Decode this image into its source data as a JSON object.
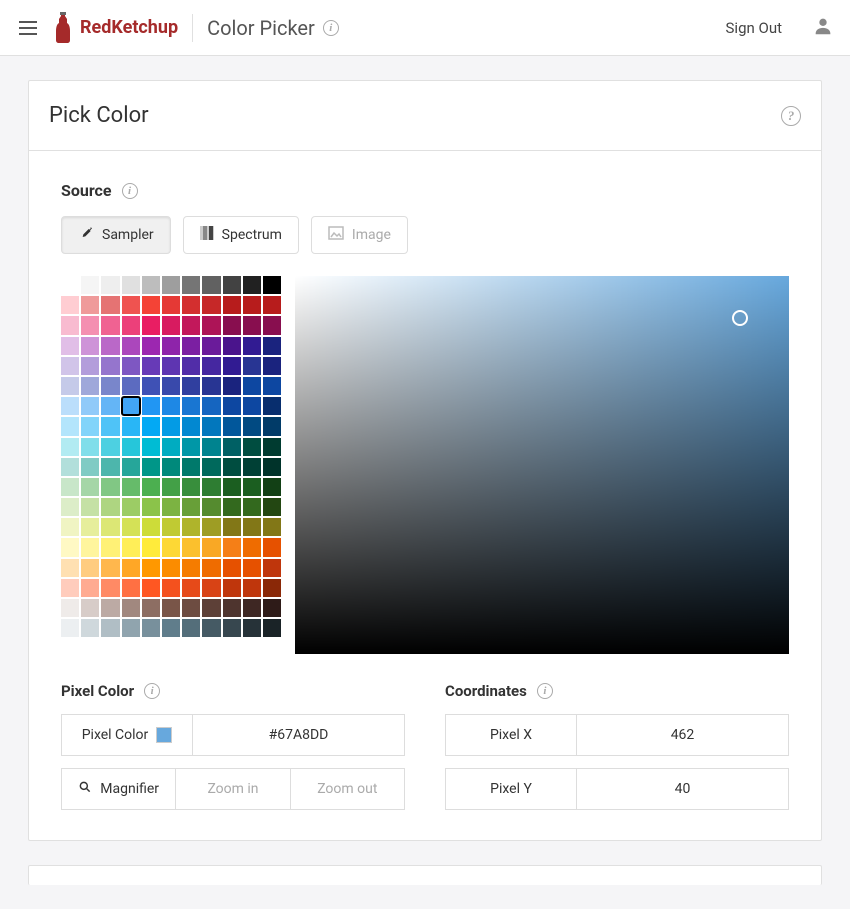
{
  "header": {
    "brand": "RedKetchup",
    "title": "Color Picker",
    "signout": "Sign Out"
  },
  "card": {
    "title": "Pick Color"
  },
  "source": {
    "label": "Source",
    "sampler": "Sampler",
    "spectrum": "Spectrum",
    "image": "Image"
  },
  "palette": {
    "rows": [
      [
        "#ffffff",
        "#f5f5f5",
        "#eeeeee",
        "#e0e0e0",
        "#bdbdbd",
        "#9e9e9e",
        "#757575",
        "#616161",
        "#424242",
        "#212121",
        "#000000"
      ],
      [
        "#ffcdd2",
        "#ef9a9a",
        "#e57373",
        "#ef5350",
        "#f44336",
        "#e53935",
        "#d32f2f",
        "#c62828",
        "#b71c1c",
        "#b71c1c",
        "#b71c1c"
      ],
      [
        "#f8bbd0",
        "#f48fb1",
        "#f06292",
        "#ec407a",
        "#e91e63",
        "#d81b60",
        "#c2185b",
        "#ad1457",
        "#880e4f",
        "#880e4f",
        "#880e4f"
      ],
      [
        "#e1bee7",
        "#ce93d8",
        "#ba68c8",
        "#ab47bc",
        "#9c27b0",
        "#8e24aa",
        "#7b1fa2",
        "#6a1b9a",
        "#4a148c",
        "#311b92",
        "#1a237e"
      ],
      [
        "#d1c4e9",
        "#b39ddb",
        "#9575cd",
        "#7e57c2",
        "#673ab7",
        "#5e35b1",
        "#512da8",
        "#4527a0",
        "#311b92",
        "#283593",
        "#1a237e"
      ],
      [
        "#c5cae9",
        "#9fa8da",
        "#7986cb",
        "#5c6bc0",
        "#3f51b5",
        "#3949ab",
        "#303f9f",
        "#283593",
        "#1a237e",
        "#0d47a1",
        "#0d47a1"
      ],
      [
        "#bbdefb",
        "#90caf9",
        "#64b5f6",
        "#42a5f5",
        "#2196f3",
        "#1e88e5",
        "#1976d2",
        "#1565c0",
        "#0d47a1",
        "#0d47a1",
        "#082e6e"
      ],
      [
        "#b3e5fc",
        "#81d4fa",
        "#4fc3f7",
        "#29b6f6",
        "#03a9f4",
        "#039be5",
        "#0288d1",
        "#0277bd",
        "#01579b",
        "#014a82",
        "#013b68"
      ],
      [
        "#b2ebf2",
        "#80deea",
        "#4dd0e1",
        "#26c6da",
        "#00bcd4",
        "#00acc1",
        "#0097a7",
        "#00838f",
        "#006064",
        "#004d40",
        "#003b30"
      ],
      [
        "#b2dfdb",
        "#80cbc4",
        "#4db6ac",
        "#26a69a",
        "#009688",
        "#00897b",
        "#00796b",
        "#00695c",
        "#004d40",
        "#004035",
        "#00332a"
      ],
      [
        "#c8e6c9",
        "#a5d6a7",
        "#81c784",
        "#66bb6a",
        "#4caf50",
        "#43a047",
        "#388e3c",
        "#2e7d32",
        "#1b5e20",
        "#1b5e20",
        "#124015"
      ],
      [
        "#dcedc8",
        "#c5e1a5",
        "#aed581",
        "#9ccc65",
        "#8bc34a",
        "#7cb342",
        "#689f38",
        "#558b2f",
        "#33691e",
        "#33691e",
        "#234712"
      ],
      [
        "#f0f4c3",
        "#e6ee9c",
        "#dce775",
        "#d4e157",
        "#cddc39",
        "#c0ca33",
        "#afb42b",
        "#9e9d24",
        "#827717",
        "#827717",
        "#827717"
      ],
      [
        "#fff9c4",
        "#fff59d",
        "#fff176",
        "#ffee58",
        "#ffeb3b",
        "#fdd835",
        "#fbc02d",
        "#f9a825",
        "#f57f17",
        "#ef6c00",
        "#e65100"
      ],
      [
        "#ffe0b2",
        "#ffcc80",
        "#ffb74d",
        "#ffa726",
        "#ff9800",
        "#fb8c00",
        "#f57c00",
        "#ef6c00",
        "#e65100",
        "#e65100",
        "#bf360c"
      ],
      [
        "#ffccbc",
        "#ffab91",
        "#ff8a65",
        "#ff7043",
        "#ff5722",
        "#f4511e",
        "#e64a19",
        "#d84315",
        "#bf360c",
        "#bf360c",
        "#8a2807"
      ],
      [
        "#efebe9",
        "#d7ccc8",
        "#bcaaa4",
        "#a1887f",
        "#8d6e63",
        "#795548",
        "#6d4c41",
        "#5d4037",
        "#4e342e",
        "#3e2723",
        "#2e1b18"
      ],
      [
        "#eceff1",
        "#cfd8dc",
        "#b0bec5",
        "#90a4ae",
        "#78909c",
        "#607d8b",
        "#546e7a",
        "#455a64",
        "#37474f",
        "#263238",
        "#1a2327"
      ]
    ],
    "selected_row": 6,
    "selected_col": 3
  },
  "gradient": {
    "sel_x_pct": 90,
    "sel_y_pct": 11
  },
  "pixel": {
    "section": "Pixel Color",
    "label": "Pixel Color",
    "hex": "#67A8DD",
    "magnifier": "Magnifier",
    "zoom_in": "Zoom in",
    "zoom_out": "Zoom out"
  },
  "coords": {
    "section": "Coordinates",
    "x_label": "Pixel X",
    "y_label": "Pixel Y",
    "x": "462",
    "y": "40"
  }
}
